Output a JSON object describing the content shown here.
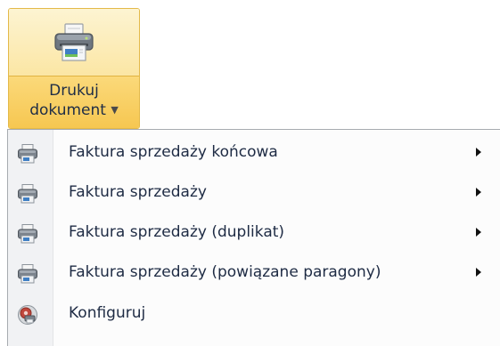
{
  "ribbon": {
    "button": {
      "line1": "Drukuj",
      "line2": "dokument",
      "icon": "printer-icon"
    }
  },
  "menu": {
    "items": [
      {
        "label": "Faktura sprzedaży końcowa",
        "icon": "printer-icon",
        "has_submenu": true
      },
      {
        "label": "Faktura sprzedaży",
        "icon": "printer-icon",
        "has_submenu": true
      },
      {
        "label": "Faktura sprzedaży (duplikat)",
        "icon": "printer-icon",
        "has_submenu": true
      },
      {
        "label": "Faktura sprzedaży (powiązane paragony)",
        "icon": "printer-icon",
        "has_submenu": true
      },
      {
        "label": "Konfiguruj",
        "icon": "configure-printer-icon",
        "has_submenu": false
      }
    ]
  },
  "colors": {
    "ribbon_highlight": "#fbd97a",
    "ribbon_border": "#e3b949",
    "menu_text": "#1e2b44"
  }
}
